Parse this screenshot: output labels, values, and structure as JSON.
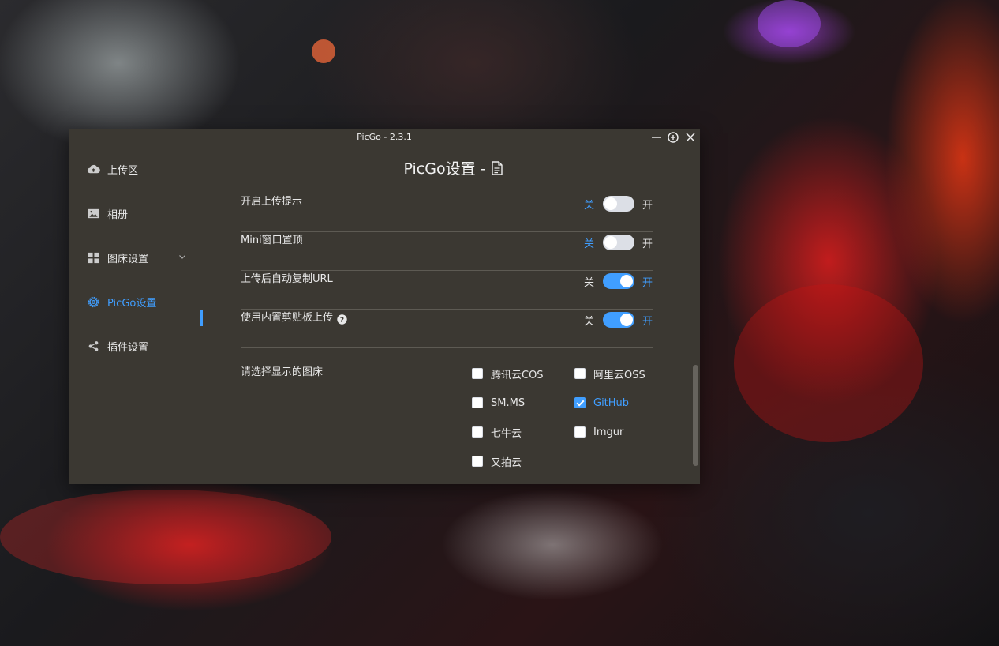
{
  "window": {
    "title": "PicGo - 2.3.1"
  },
  "sidebar": {
    "items": [
      {
        "label": "上传区",
        "icon": "cloud-upload-icon",
        "active": false
      },
      {
        "label": "相册",
        "icon": "image-icon",
        "active": false
      },
      {
        "label": "图床设置",
        "icon": "grid-icon",
        "active": false,
        "expandable": true
      },
      {
        "label": "PicGo设置",
        "icon": "gear-icon",
        "active": true
      },
      {
        "label": "插件设置",
        "icon": "share-icon",
        "active": false
      }
    ]
  },
  "main": {
    "title": "PicGo设置 -",
    "settings": [
      {
        "label": "开启上传提示",
        "off_label": "关",
        "on_label": "开",
        "checked": false,
        "help": false
      },
      {
        "label": "Mini窗口置顶",
        "off_label": "关",
        "on_label": "开",
        "checked": false,
        "help": false
      },
      {
        "label": "上传后自动复制URL",
        "off_label": "关",
        "on_label": "开",
        "checked": true,
        "help": false
      },
      {
        "label": "使用内置剪贴板上传",
        "off_label": "关",
        "on_label": "开",
        "checked": true,
        "help": true
      }
    ],
    "picbed": {
      "label": "请选择显示的图床",
      "options": [
        {
          "label": "腾讯云COS",
          "checked": false
        },
        {
          "label": "阿里云OSS",
          "checked": false
        },
        {
          "label": "SM.MS",
          "checked": false
        },
        {
          "label": "GitHub",
          "checked": true
        },
        {
          "label": "七牛云",
          "checked": false
        },
        {
          "label": "Imgur",
          "checked": false
        },
        {
          "label": "又拍云",
          "checked": false
        }
      ]
    }
  },
  "colors": {
    "accent": "#409eff",
    "window_bg": "#3b3832",
    "divider": "#5d5a53"
  }
}
